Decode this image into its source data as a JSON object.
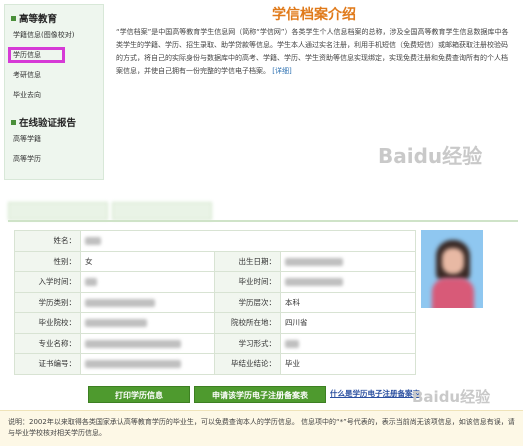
{
  "sidebar": {
    "section1_title": "高等教育",
    "items1": [
      "学籍信息(图像校对)",
      "学历信息",
      "考研信息",
      "毕业去向"
    ],
    "section2_title": "在线验证报告",
    "items2": [
      "高等学籍",
      "高等学历"
    ]
  },
  "intro": {
    "title": "学信档案介绍",
    "body": "“学信档案”是中国高等教育学生信息网（简称“学信网”）各类学生个人信息档案的总称，涉及全国高等教育学生信息数据库中各类学生的学籍、学历、招生录取、助学贷款等信息。学生本人通过实名注册，利用手机短信（免费短信）或邮箱获取注册校验码的方式，将自己的实际身份与数据库中的高考、学籍、学历、学生资助等信息实现绑定，实现免费注册和免费查询所有的个人档案信息，并使自己拥有一份完整的学信电子档案。",
    "more": "[详细]"
  },
  "watermark": "Baidu经验",
  "table": {
    "labels": {
      "name": "姓名：",
      "gender": "性别：",
      "birth": "出生日期：",
      "enroll": "入学时间：",
      "grad": "毕业时间：",
      "type": "学历类别：",
      "level": "学历层次：",
      "school": "毕业院校：",
      "location": "院校所在地：",
      "major": "专业名称：",
      "form": "学习形式：",
      "cert": "证书编号：",
      "result": "毕结业结论："
    },
    "values": {
      "gender": "女",
      "level": "本科",
      "location": "四川省",
      "result": "毕业"
    }
  },
  "buttons": {
    "print": "打印学历信息",
    "apply": "申请该学历电子注册备案表",
    "what_link": "什么是学历电子注册备案表"
  },
  "note": "说明：2002年以来取得各类国家承认高等教育学历的毕业生，可以免费查询本人的学历信息。 信息项中的“*”号代表的，表示当前尚无该项信息，如该信息有误，请与毕业学校核对相关学历信息。"
}
